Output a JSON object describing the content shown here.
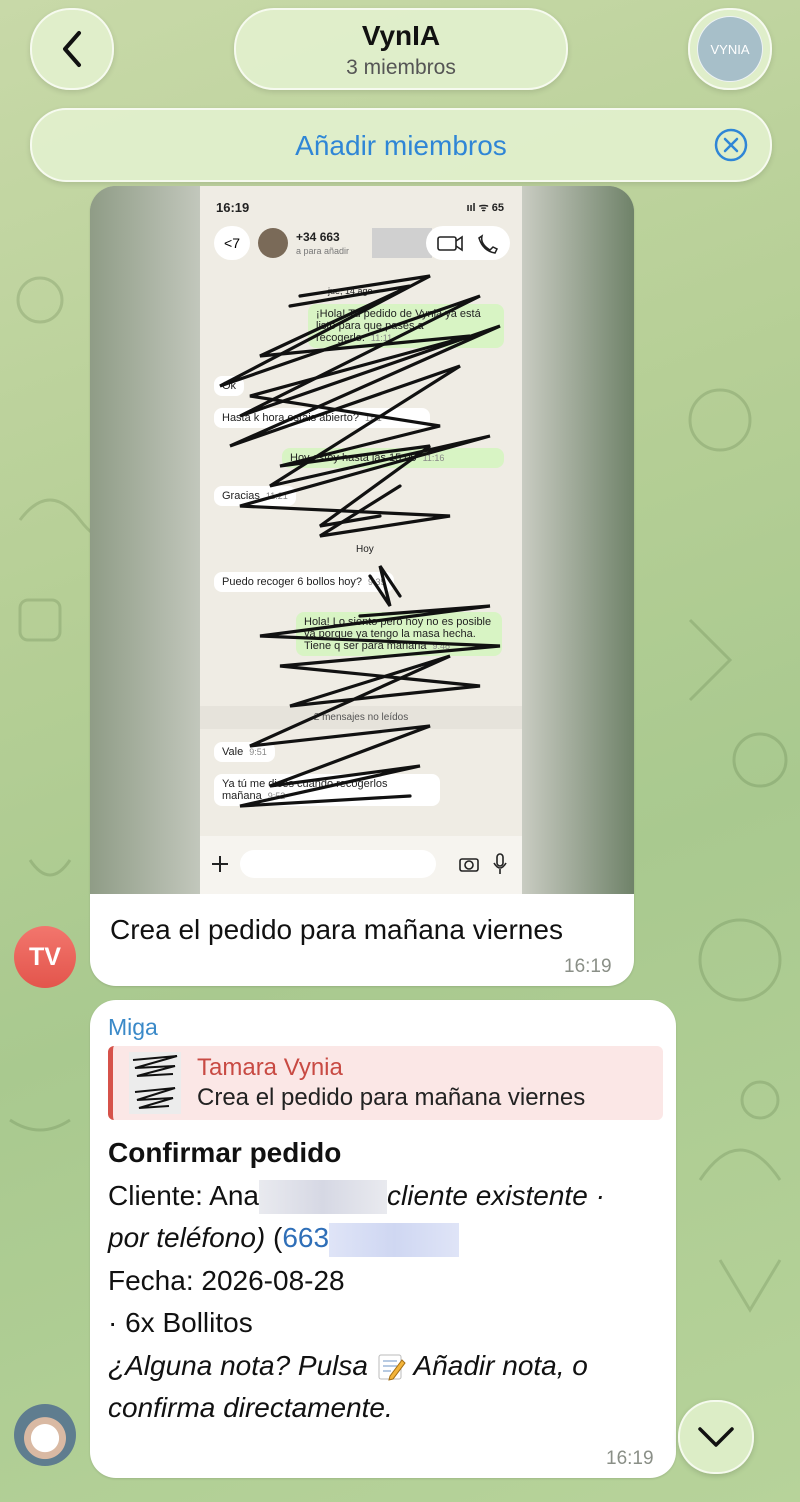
{
  "header": {
    "title": "VynIA",
    "subtitle": "3 miembros",
    "avatar_text": "VYNIA",
    "add_members_label": "Añadir miembros"
  },
  "messages": [
    {
      "sender_initials": "TV",
      "screenshot": {
        "status_time": "16:19",
        "status_icons": "ııl ᯤ 65",
        "back_count": "<7",
        "contact_number": "+34 663",
        "contact_sub": "a para añadir",
        "date_label": "jue, 14 ago",
        "chat": [
          {
            "dir": "out",
            "text": "¡Hola! Tu pedido de Vynia ya está listo para que pases a recogerlo.",
            "time": "11:11"
          },
          {
            "dir": "in",
            "text": "Ok",
            "time": ""
          },
          {
            "dir": "in",
            "text": "Hasta k hora estáis abierto?",
            "time": "11:1"
          },
          {
            "dir": "out",
            "text": "Hoy estoy hasta las 15:00",
            "time": "11:16"
          },
          {
            "dir": "in",
            "text": "Gracias",
            "time": "11:21"
          },
          {
            "dir": "in",
            "text": "Puedo recoger 6 bollos hoy?",
            "time": "9:39"
          },
          {
            "dir": "out",
            "text": "Hola! Lo siento pero hoy no es posible ya porque ya tengo la masa hecha. Tiene q ser para mañana",
            "time": "9:48"
          },
          {
            "dir": "in",
            "text": "Vale",
            "time": "9:51"
          },
          {
            "dir": "in",
            "text": "Ya tú me dices cuando recogerlos mañana",
            "time": "9:52"
          }
        ],
        "today_label": "Hoy",
        "unread_label": "2 mensajes no leídos"
      },
      "caption": "Crea el pedido para mañana viernes",
      "time": "16:19"
    },
    {
      "sender": "Miga",
      "reply_name": "Tamara Vynia",
      "reply_text": "Crea el pedido para mañana viernes",
      "title": "Confirmar pedido",
      "client_prefix": "Cliente: Ana",
      "client_italic_1": "cliente existente ·",
      "client_italic_2": "por teléfono)",
      "phone_open": "(",
      "phone_prefix": "663",
      "date_line": "Fecha: 2026-08-28",
      "item_line": "· 6x Bollitos",
      "note_part1": "¿Alguna nota? Pulsa",
      "note_part2": "Añadir nota, o",
      "note_part3": "confirma directamente.",
      "time": "16:19"
    }
  ],
  "colors": {
    "accent": "#2f86d6",
    "reply_accent": "#d6524a",
    "sender_name": "#3a89c8",
    "avatar_tv": "#e9645c"
  }
}
